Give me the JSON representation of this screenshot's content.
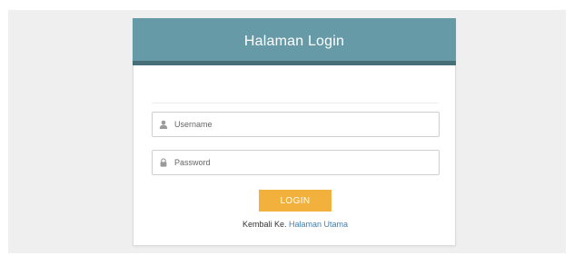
{
  "header": {
    "title": "Halaman Login"
  },
  "form": {
    "username_placeholder": "Username",
    "password_placeholder": "Password",
    "username_icon": "user-icon",
    "password_icon": "lock-icon",
    "login_label": "LOGIN"
  },
  "footer": {
    "back_prefix": "Kembali Ke.",
    "back_link": "Halaman Utama"
  },
  "colors": {
    "header": "#669aa7",
    "header_bar": "#466f78",
    "button": "#f2b13c",
    "link": "#3f7fb5",
    "background": "#efefef"
  }
}
